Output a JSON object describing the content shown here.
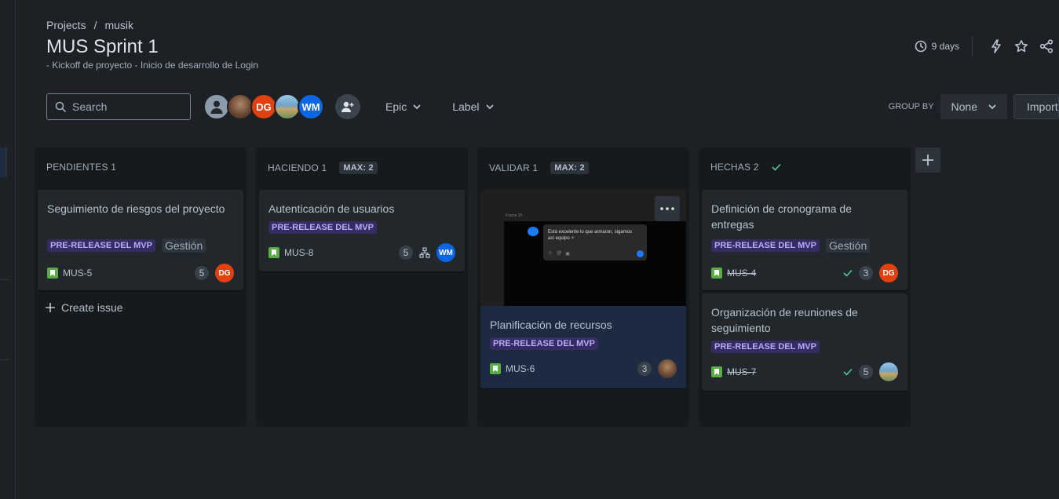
{
  "breadcrumb": {
    "projects": "Projects",
    "separator": "/",
    "project": "musik"
  },
  "title": "MUS Sprint 1",
  "subtitle": "- Kickoff de proyecto - Inicio de desarrollo de Login",
  "sprint": {
    "days_left": "9 days"
  },
  "toolbar": {
    "search_placeholder": "Search",
    "avatars": [
      {
        "kind": "user-placeholder",
        "initials": ""
      },
      {
        "kind": "photo",
        "initials": ""
      },
      {
        "kind": "initials",
        "initials": "DG",
        "color": "#e2410f"
      },
      {
        "kind": "photo",
        "initials": ""
      },
      {
        "kind": "initials",
        "initials": "WM",
        "color": "#0c66e4"
      }
    ],
    "epic_filter": "Epic",
    "label_filter": "Label",
    "group_by_label": "GROUP BY",
    "group_by_value": "None",
    "import_label": "Import"
  },
  "columns": [
    {
      "name": "PENDIENTES 1",
      "max": "",
      "done": false,
      "create_issue": "Create issue",
      "cards": [
        {
          "title": "Seguimiento de riesgos del proyecto",
          "epic": "PRE-RELEASE DEL MVP",
          "label": "Gestión",
          "key": "MUS-5",
          "points": "5",
          "assignee": "DG",
          "done": false
        }
      ]
    },
    {
      "name": "HACIENDO 1",
      "max": "MAX: 2",
      "done": false,
      "cards": [
        {
          "title": "Autenticación de usuarios",
          "epic": "PRE-RELEASE DEL MVP",
          "label": "",
          "key": "MUS-8",
          "points": "5",
          "assignee": "WM",
          "done": false
        }
      ]
    },
    {
      "name": "VALIDAR 1",
      "max": "MAX: 2",
      "done": false,
      "cards": [
        {
          "title": "Planificación de recursos",
          "epic": "PRE-RELEASE DEL MVP",
          "label": "",
          "key": "MUS-6",
          "points": "3",
          "assignee": "",
          "done": false,
          "attachment": {
            "frame_label": "Frame 25",
            "message": "Está excelente lo que armaron, sigamos así equipo ⚡"
          }
        }
      ]
    },
    {
      "name": "HECHAS 2",
      "max": "",
      "done": true,
      "cards": [
        {
          "title": "Definición de cronograma de entregas",
          "epic": "PRE-RELEASE DEL MVP",
          "label": "Gestión",
          "key": "MUS-4",
          "points": "3",
          "assignee": "DG",
          "done": true
        },
        {
          "title": "Organización de reuniones de seguimiento",
          "epic": "PRE-RELEASE DEL MVP",
          "label": "",
          "key": "MUS-7",
          "points": "5",
          "assignee": "",
          "done": true
        }
      ]
    }
  ],
  "colors": {
    "background": "#1d2125",
    "column": "#161a1d",
    "card": "#22272b",
    "selected_card": "#1c2b41",
    "epic": "#352c63",
    "epic_text": "#b8acf6",
    "story": "#5aac44",
    "done_check": "#4bce97"
  }
}
